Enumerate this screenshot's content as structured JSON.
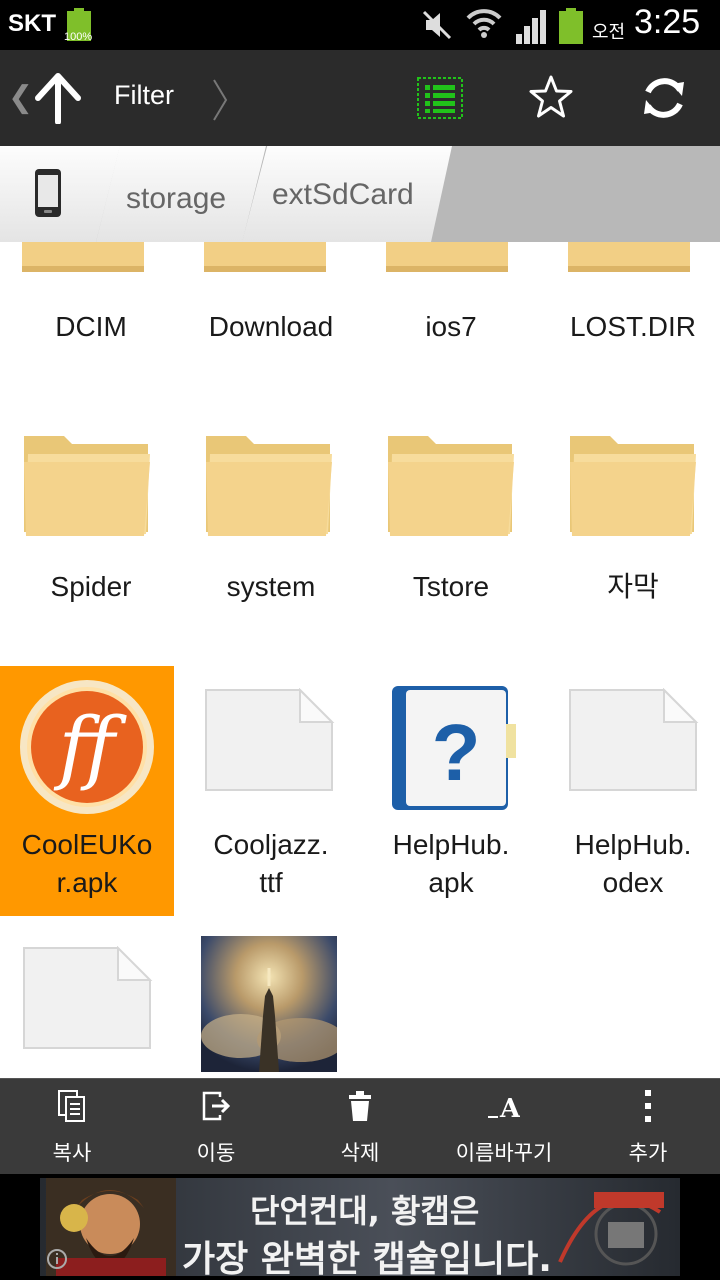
{
  "status": {
    "carrier": "SKT",
    "battery_pct": "100%",
    "ampm": "오전",
    "time": "3:25"
  },
  "toolbar": {
    "filter_label": "Filter",
    "icons": [
      "up-arrow-icon",
      "list-view-icon",
      "star-icon",
      "refresh-icon"
    ],
    "accent": "#21c21a"
  },
  "breadcrumb": {
    "items": [
      "storage",
      "extSdCard"
    ]
  },
  "files": [
    {
      "name": "DCIM",
      "type": "folder"
    },
    {
      "name": "Download",
      "type": "folder"
    },
    {
      "name": "ios7",
      "type": "folder"
    },
    {
      "name": "LOST.DIR",
      "type": "folder"
    },
    {
      "name": "Spider",
      "type": "folder"
    },
    {
      "name": "system",
      "type": "folder"
    },
    {
      "name": "Tstore",
      "type": "folder"
    },
    {
      "name": "자막",
      "type": "folder"
    },
    {
      "name_line1": "CoolEUKo",
      "name_line2": "r.apk",
      "type": "apk",
      "selected": true
    },
    {
      "name_line1": "Cooljazz.",
      "name_line2": "ttf",
      "type": "file"
    },
    {
      "name_line1": "HelpHub.",
      "name_line2": "apk",
      "type": "apk"
    },
    {
      "name_line1": "HelpHub.",
      "name_line2": "odex",
      "type": "file"
    },
    {
      "type": "file"
    },
    {
      "type": "image"
    }
  ],
  "actions": {
    "copy": "복사",
    "move": "이동",
    "delete": "삭제",
    "rename": "이름바꾸기",
    "more": "추가"
  },
  "ad": {
    "line1": "단언컨대, 황캡은",
    "line2": "가장 완벽한 캡슐입니다."
  },
  "colors": {
    "selection": "#ff9800",
    "folder": "#f5d48a"
  }
}
